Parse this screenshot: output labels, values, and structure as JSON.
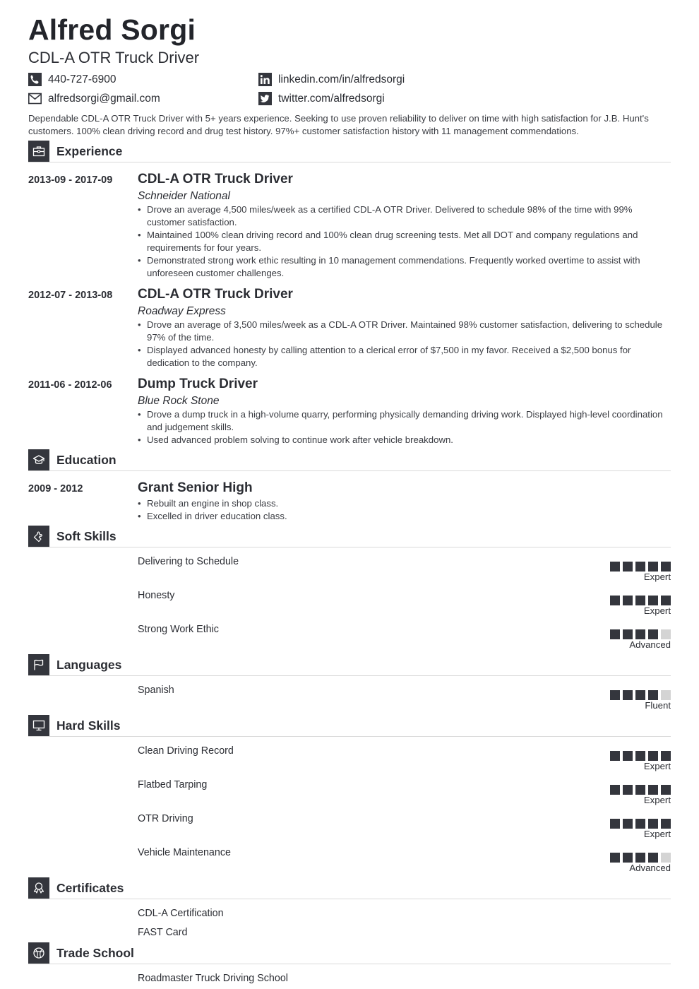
{
  "header": {
    "name": "Alfred Sorgi",
    "title": "CDL-A OTR Truck Driver"
  },
  "contact": {
    "phone": "440-727-6900",
    "email": "alfredsorgi@gmail.com",
    "linkedin": "linkedin.com/in/alfredsorgi",
    "twitter": "twitter.com/alfredsorgi"
  },
  "summary": "Dependable CDL-A OTR Truck Driver with 5+ years experience. Seeking to use proven reliability to deliver on time with high satisfaction for J.B. Hunt's customers. 100% clean driving record and drug test history. 97%+ customer satisfaction history with 11 management commendations.",
  "sections": {
    "experience": "Experience",
    "education": "Education",
    "soft_skills": "Soft Skills",
    "languages": "Languages",
    "hard_skills": "Hard Skills",
    "certificates": "Certificates",
    "trade_school": "Trade School"
  },
  "experience": [
    {
      "dates": "2013-09 - 2017-09",
      "title": "CDL-A OTR Truck Driver",
      "company": "Schneider National",
      "bullets": [
        "Drove an average 4,500 miles/week as a certified CDL-A OTR Driver. Delivered to schedule 98% of the time with 99% customer satisfaction.",
        "Maintained 100% clean driving record and 100% clean drug screening tests. Met all DOT and company regulations and requirements for four years.",
        "Demonstrated strong work ethic resulting in 10 management commendations. Frequently worked overtime to assist with unforeseen customer challenges."
      ]
    },
    {
      "dates": "2012-07 - 2013-08",
      "title": "CDL-A OTR Truck Driver",
      "company": "Roadway Express",
      "bullets": [
        "Drove an average of 3,500 miles/week as a CDL-A OTR Driver. Maintained 98% customer satisfaction, delivering to schedule 97% of the time.",
        "Displayed advanced honesty by calling attention to a clerical error of $7,500 in my favor. Received a $2,500 bonus for dedication to the company."
      ]
    },
    {
      "dates": "2011-06 - 2012-06",
      "title": "Dump Truck Driver",
      "company": "Blue Rock Stone",
      "bullets": [
        "Drove a dump truck in a high-volume quarry, performing physically demanding driving work. Displayed high-level coordination and judgement skills.",
        "Used advanced problem solving to continue work after vehicle breakdown."
      ]
    }
  ],
  "education": [
    {
      "dates": "2009 - 2012",
      "school": "Grant Senior High",
      "bullets": [
        "Rebuilt an engine in shop class.",
        "Excelled in driver education class."
      ]
    }
  ],
  "soft_skills": [
    {
      "name": "Delivering to Schedule",
      "level": "Expert",
      "rating": 5,
      "max": 5
    },
    {
      "name": "Honesty",
      "level": "Expert",
      "rating": 5,
      "max": 5
    },
    {
      "name": "Strong Work Ethic",
      "level": "Advanced",
      "rating": 4,
      "max": 5
    }
  ],
  "languages": [
    {
      "name": "Spanish",
      "level": "Fluent",
      "rating": 4,
      "max": 5
    }
  ],
  "hard_skills": [
    {
      "name": "Clean Driving Record",
      "level": "Expert",
      "rating": 5,
      "max": 5
    },
    {
      "name": "Flatbed Tarping",
      "level": "Expert",
      "rating": 5,
      "max": 5
    },
    {
      "name": "OTR Driving",
      "level": "Expert",
      "rating": 5,
      "max": 5
    },
    {
      "name": "Vehicle Maintenance",
      "level": "Advanced",
      "rating": 4,
      "max": 5
    }
  ],
  "certificates": [
    "CDL-A Certification",
    "FAST Card"
  ],
  "trade_school": [
    "Roadmaster Truck Driving School"
  ],
  "colors": {
    "accent": "#34363d",
    "text": "#2b2d33",
    "rating_off": "#d4d4d4",
    "divider": "#d9d9d9"
  }
}
